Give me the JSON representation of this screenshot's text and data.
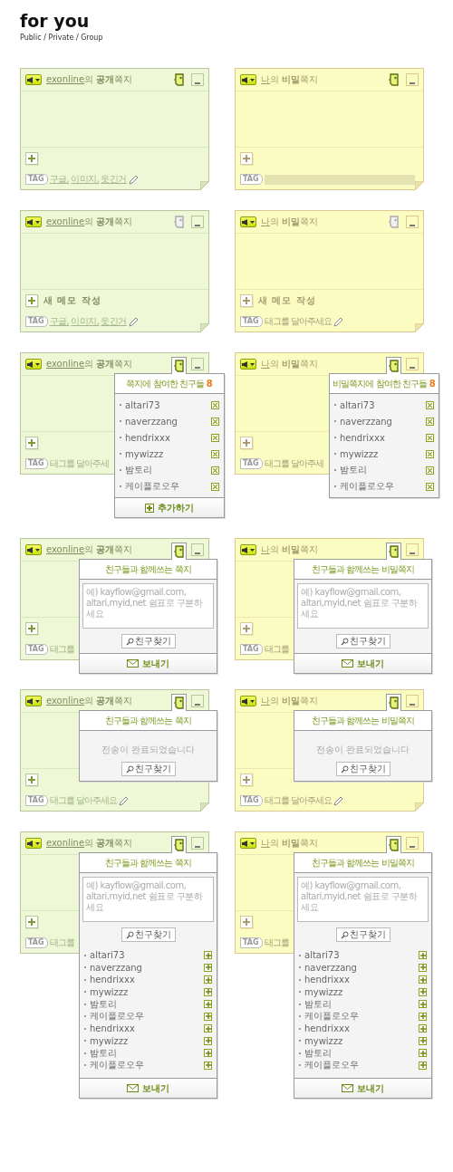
{
  "page": {
    "title": "for you",
    "subtitle": "Public / Private / Group"
  },
  "rows": [
    {
      "notes": [
        {
          "kind": "public",
          "owner": "exonline",
          "title": "의 **공개**쪽지",
          "friends_active": true,
          "tag_label": "TAG",
          "tags": {
            "kind": "links",
            "items": [
              "구글,",
              "이미지,",
              "웃긴거"
            ]
          },
          "pencil": true
        },
        {
          "kind": "secret",
          "owner": "나",
          "title": "의 **비밀**쪽지",
          "friends_active": true,
          "tag_label": "TAG",
          "tags": {
            "kind": "input"
          },
          "pencil": false
        }
      ]
    },
    {
      "notes": [
        {
          "kind": "public",
          "owner": "exonline",
          "title": "의 **공개**쪽지",
          "friends_active": false,
          "new_memo": "새 메모 작성",
          "tag_label": "TAG",
          "tags": {
            "kind": "links",
            "items": [
              "구글,",
              "이미지,",
              "웃긴거"
            ]
          },
          "pencil": true
        },
        {
          "kind": "secret",
          "owner": "나",
          "title": "의 **비밀**쪽지",
          "friends_active": false,
          "new_memo": "새 메모 작성",
          "tag_label": "TAG",
          "tags": {
            "kind": "hint",
            "text": "태그를 달아주세요"
          },
          "pencil": true
        }
      ]
    },
    {
      "notes": [
        {
          "kind": "public",
          "owner": "exonline",
          "title": "의 **공개**쪽지",
          "friends_active": true,
          "tag_label": "TAG",
          "tags": {
            "kind": "hint",
            "text": "태그를 달아주세"
          },
          "pencil": false,
          "popup": {
            "kind": "friends",
            "title": "쪽지에 참여한 친구들",
            "count": "8",
            "friends": [
              "altari73",
              "naverzzang",
              "hendrixxx",
              "mywizzz",
              "밤토리",
              "케이플로오우"
            ],
            "action": "추가하기"
          }
        },
        {
          "kind": "secret",
          "owner": "나",
          "title": "의 **비밀**쪽지",
          "friends_active": true,
          "tag_label": "TAG",
          "tags": {
            "kind": "hint",
            "text": "태그를 달아주세"
          },
          "pencil": false,
          "popup": {
            "kind": "friends",
            "title": "비밀쪽지에 참여한 친구들",
            "count": "8",
            "friends": [
              "altari73",
              "naverzzang",
              "hendrixxx",
              "mywizzz",
              "밤토리",
              "케이플로오우"
            ]
          }
        }
      ]
    },
    {
      "notes": [
        {
          "kind": "public",
          "owner": "exonline",
          "title": "의 **공개**쪽지",
          "friends_active": true,
          "tag_label": "TAG",
          "tags": {
            "kind": "hint",
            "text": "태그를"
          },
          "pencil": false,
          "popup": {
            "kind": "compose",
            "title": "친구들과 함께쓰는 쪽지",
            "placeholder": "예) kayflow@gmail.com, altari,myid,net 쉼표로 구분하세요",
            "search": "친구찾기",
            "action": "보내기"
          }
        },
        {
          "kind": "secret",
          "owner": "나",
          "title": "의 **비밀**쪽지",
          "friends_active": true,
          "tag_label": "TAG",
          "tags": {
            "kind": "hint",
            "text": "태그를"
          },
          "pencil": false,
          "popup": {
            "kind": "compose",
            "title": "친구들과 함께쓰는 비밀쪽지",
            "placeholder": "예) kayflow@gmail.com, altari,myid,net 쉼표로 구분하세요",
            "search": "친구찾기",
            "action": "보내기"
          }
        }
      ]
    },
    {
      "notes": [
        {
          "kind": "public",
          "owner": "exonline",
          "title": "의 **공개**쪽지",
          "friends_active": true,
          "tag_label": "TAG",
          "tags": {
            "kind": "hint",
            "text": "태그를 달아주세요"
          },
          "pencil": true,
          "popup": {
            "kind": "sent",
            "title": "친구들과 함께쓰는 쪽지",
            "message": "전송이 완료되었습니다",
            "search": "친구찾기"
          }
        },
        {
          "kind": "secret",
          "owner": "나",
          "title": "의 **비밀**쪽지",
          "friends_active": true,
          "tag_label": "TAG",
          "tags": {
            "kind": "hint",
            "text": "태그를 달아주세요"
          },
          "pencil": true,
          "popup": {
            "kind": "sent",
            "title": "친구들과 함께쓰는 비밀쪽지",
            "message": "전송이 완료되었습니다",
            "search": "친구찾기"
          }
        }
      ]
    },
    {
      "notes": [
        {
          "kind": "public",
          "owner": "exonline",
          "title": "의 **공개**쪽지",
          "friends_active": true,
          "tag_label": "TAG",
          "tags": {
            "kind": "hint",
            "text": "태그를"
          },
          "pencil": false,
          "popup": {
            "kind": "compose",
            "title": "친구들과 함께쓰는 쪽지",
            "placeholder": "예) kayflow@gmail.com, altari,myid,net 쉼표로 구분하세요",
            "search": "친구찾기",
            "friends": [
              "altari73",
              "naverzzang",
              "hendrixxx",
              "mywizzz",
              "밤토리",
              "케이플로오우",
              "hendrixxx",
              "mywizzz",
              "밤토리",
              "케이플로오우"
            ],
            "action": "보내기"
          }
        },
        {
          "kind": "secret",
          "owner": "나",
          "title": "의 **비밀**쪽지",
          "friends_active": true,
          "tag_label": "TAG",
          "tags": {
            "kind": "hint",
            "text": "태그를"
          },
          "pencil": false,
          "popup": {
            "kind": "compose",
            "title": "친구들과 함께쓰는 비밀쪽지",
            "placeholder": "예) kayflow@gmail.com, altari,myid,net 쉼표로 구분하세요",
            "search": "친구찾기",
            "friends": [
              "altari73",
              "naverzzang",
              "hendrixxx",
              "mywizzz",
              "밤토리",
              "케이플로오우",
              "hendrixxx",
              "mywizzz",
              "밤토리",
              "케이플로오우"
            ],
            "action": "보내기"
          }
        }
      ]
    }
  ]
}
